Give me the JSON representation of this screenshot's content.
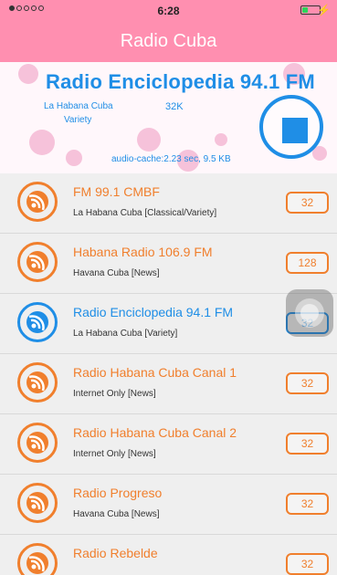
{
  "statusbar": {
    "time": "6:28",
    "charge_icon": "lightning-icon"
  },
  "app": {
    "title": "Radio Cuba"
  },
  "now_playing": {
    "title": "Radio Enciclopedia 94.1 FM",
    "location": "La Habana Cuba",
    "bitrate": "32K",
    "genre": "Variety",
    "cache": "audio-cache:2.23 sec, 9.5 KB",
    "button_icon": "stop-icon"
  },
  "stations": [
    {
      "name": "FM 99.1 CMBF",
      "sub": "La Habana Cuba [Classical/Variety]",
      "bitrate": "32",
      "active": false
    },
    {
      "name": "Habana Radio 106.9 FM",
      "sub": "Havana Cuba [News]",
      "bitrate": "128",
      "active": false
    },
    {
      "name": "Radio Enciclopedia 94.1 FM",
      "sub": "La Habana Cuba [Variety]",
      "bitrate": "32",
      "active": true
    },
    {
      "name": "Radio Habana Cuba Canal 1",
      "sub": "Internet Only [News]",
      "bitrate": "32",
      "active": false
    },
    {
      "name": "Radio Habana Cuba Canal 2",
      "sub": "Internet Only [News]",
      "bitrate": "32",
      "active": false
    },
    {
      "name": "Radio Progreso",
      "sub": "Havana Cuba [News]",
      "bitrate": "32",
      "active": false
    },
    {
      "name": "Radio Rebelde",
      "sub": "",
      "bitrate": "32",
      "active": false
    }
  ],
  "colors": {
    "accent_orange": "#f07f2d",
    "accent_blue": "#1f8ee6",
    "nav_pink": "#ff8fb0"
  }
}
